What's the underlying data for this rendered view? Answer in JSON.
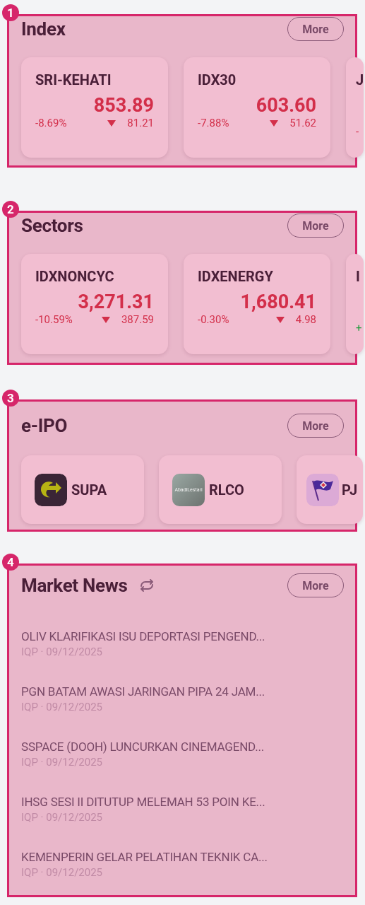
{
  "sections": [
    {
      "badge": "1",
      "kind": "quotes",
      "title": "Index",
      "more": "More",
      "cards": [
        {
          "name": "SRI-KEHATI",
          "value": "853.89",
          "change_pct": "-8.69%",
          "change": "81.21",
          "kind": "down"
        },
        {
          "name": "IDX30",
          "value": "603.60",
          "change_pct": "-7.88%",
          "change": "51.62",
          "kind": "down"
        },
        {
          "name": "J",
          "change_pct": "-",
          "kind": "down"
        }
      ]
    },
    {
      "badge": "2",
      "kind": "quotes",
      "title": "Sectors",
      "more": "More",
      "cards": [
        {
          "name": "IDXNONCYC",
          "value": "3,271.31",
          "change_pct": "-10.59%",
          "change": "387.59",
          "kind": "down"
        },
        {
          "name": "IDXENERGY",
          "value": "1,680.41",
          "change_pct": "-0.30%",
          "change": "4.98",
          "kind": "down"
        },
        {
          "name": "I",
          "change_pct": "+",
          "kind": "up"
        }
      ]
    },
    {
      "badge": "3",
      "kind": "ipo",
      "title": "e-IPO",
      "more": "More",
      "items": [
        {
          "ticker": "SUPA",
          "kind": "swoosh"
        },
        {
          "ticker": "RLCO",
          "kind": "wordmark",
          "logo_text": "AbadiLestari"
        },
        {
          "ticker": "PJ",
          "kind": "flag"
        }
      ]
    },
    {
      "badge": "4",
      "kind": "news",
      "title": "Market News",
      "more": "More",
      "news": [
        {
          "headline": "OLIV KLARIFIKASI ISU DEPORTASI PENGEND...",
          "meta": "IQP · 09/12/2025"
        },
        {
          "headline": "PGN BATAM AWASI JARINGAN PIPA 24 JAM...",
          "meta": "IQP · 09/12/2025"
        },
        {
          "headline": "SSPACE (DOOH) LUNCURKAN CINEMAGEND...",
          "meta": "IQP · 09/12/2025"
        },
        {
          "headline": "IHSG SESI II DITUTUP MELEMAH 53 POIN KE...",
          "meta": "IQP · 09/12/2025"
        },
        {
          "headline": "KEMENPERIN GELAR PELATIHAN TEKNIK CA...",
          "meta": "IQP · 09/12/2025"
        }
      ]
    }
  ]
}
